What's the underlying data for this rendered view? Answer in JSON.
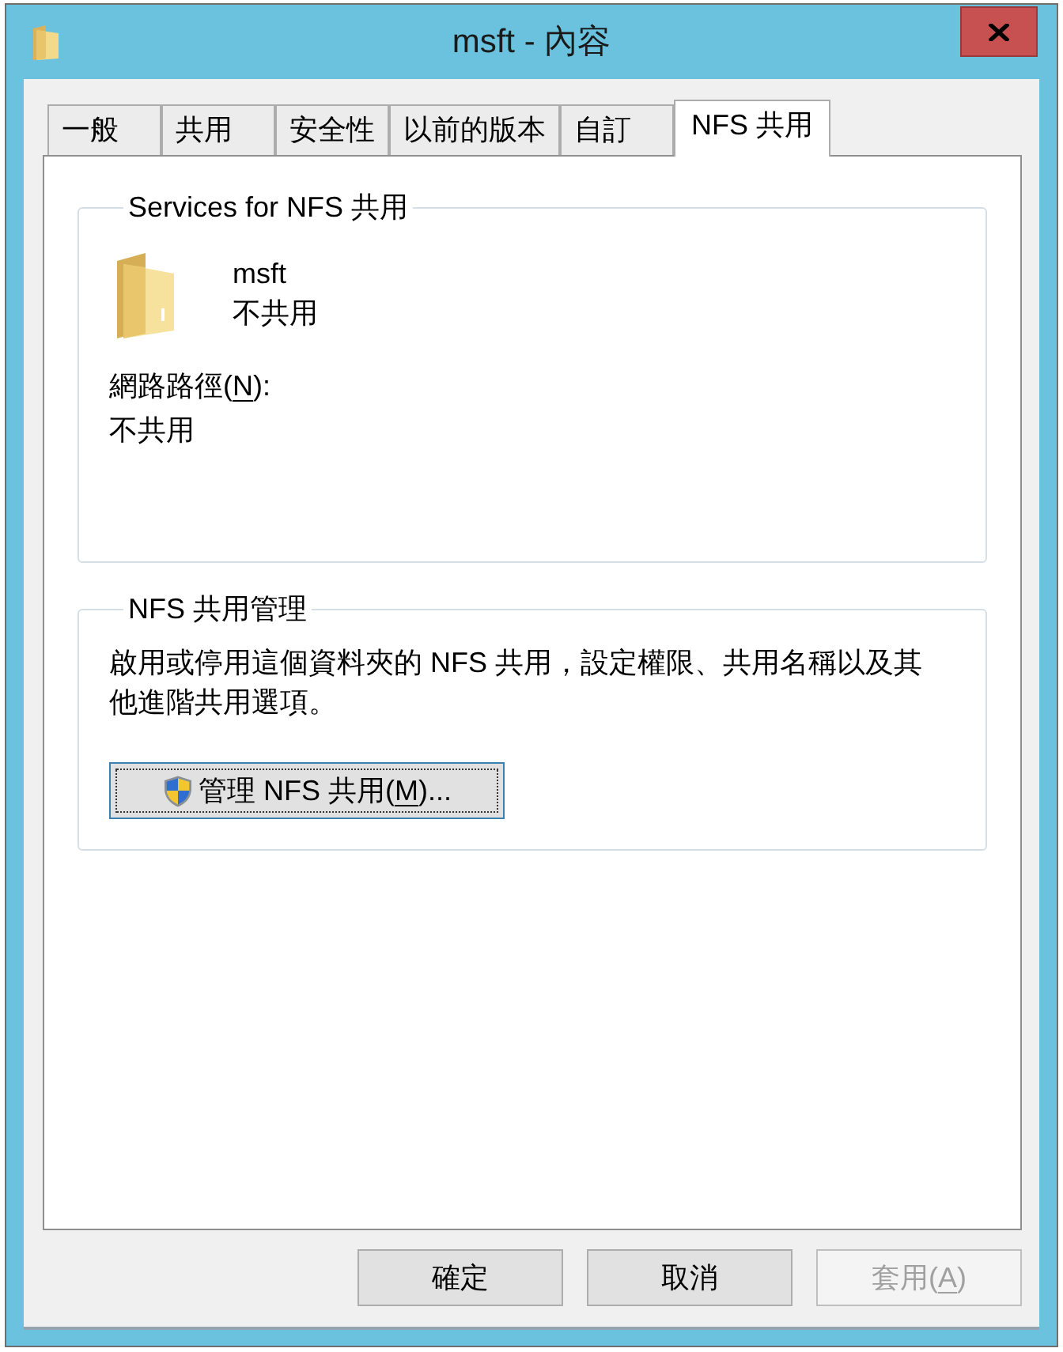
{
  "window": {
    "title": "msft - 內容"
  },
  "tabs": [
    {
      "label": "一般",
      "selected": false
    },
    {
      "label": "共用",
      "selected": false
    },
    {
      "label": "安全性",
      "selected": false
    },
    {
      "label": "以前的版本",
      "selected": false
    },
    {
      "label": "自訂",
      "selected": false
    },
    {
      "label": "NFS 共用",
      "selected": true
    }
  ],
  "services_group": {
    "title": "Services for NFS 共用",
    "folder": {
      "name": "msft",
      "status": "不共用"
    },
    "network_path": {
      "label": {
        "before": "網路路徑(",
        "access_key": "N",
        "after": "):"
      },
      "value": "不共用"
    }
  },
  "management_group": {
    "title": "NFS 共用管理",
    "description": "啟用或停用這個資料夾的 NFS 共用，設定權限、共用名稱以及其他進階共用選項。",
    "manage_button": {
      "label": {
        "before": "管理 NFS 共用(",
        "access_key": "M",
        "after": ")..."
      },
      "focused": true
    }
  },
  "buttons": [
    {
      "label": {
        "before": "確定"
      },
      "disabled": false
    },
    {
      "label": {
        "before": "取消"
      },
      "disabled": false
    },
    {
      "label": {
        "before": "套用(",
        "access_key": "A",
        "after": ")"
      },
      "disabled": true
    }
  ]
}
